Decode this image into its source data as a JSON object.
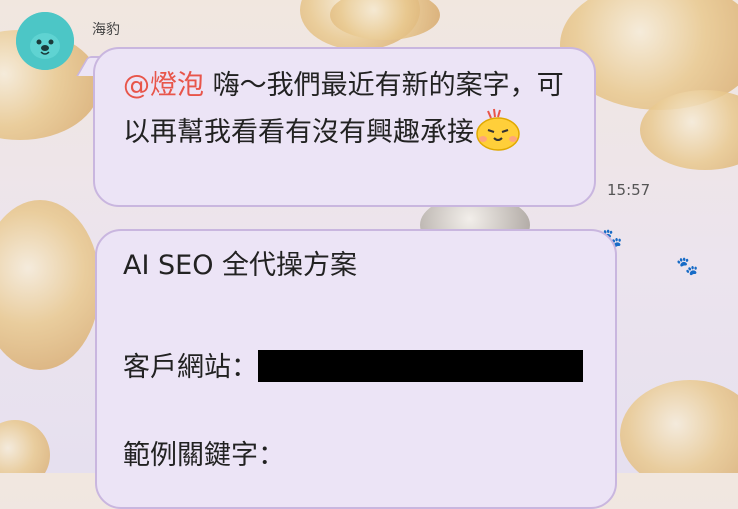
{
  "chat": {
    "sender_name": "海豹",
    "message1": {
      "mention": "@燈泡",
      "text": " 嗨～我們最近有新的案字，可以再幫我看看有沒有興趣承接",
      "sticker": "yellow-chick-sticker",
      "time": "15:57"
    },
    "message2": {
      "title": "AI SEO 全代操方案",
      "website_label": "客戶網站：",
      "keywords_label": "範例關鍵字："
    }
  },
  "colors": {
    "bubble_bg": "#ece4f6",
    "bubble_border": "#c9b6df",
    "mention": "#e8554a",
    "avatar_bg": "#4cc6c6"
  }
}
